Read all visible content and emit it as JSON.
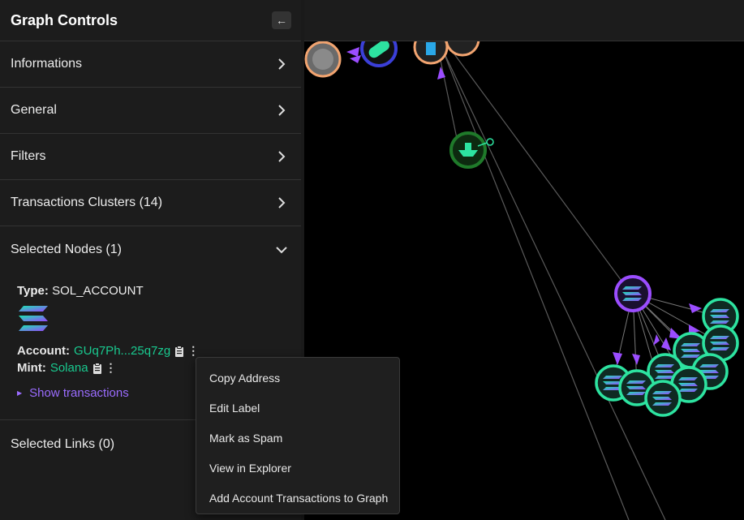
{
  "sidebar": {
    "title": "Graph Controls",
    "collapse_icon": "←",
    "sections": [
      {
        "label": "Informations"
      },
      {
        "label": "General"
      },
      {
        "label": "Filters"
      },
      {
        "label": "Transactions Clusters (14)"
      },
      {
        "label": "Selected Nodes (1)"
      }
    ],
    "selected_node": {
      "type_label": "Type:",
      "type_value": "SOL_ACCOUNT",
      "account_label": "Account:",
      "account_value": "GUq7Ph...25q7zg",
      "mint_label": "Mint:",
      "mint_value": "Solana",
      "more_icon": "⋮",
      "show_transactions": "Show transactions"
    },
    "selected_links": "Selected Links (0)"
  },
  "context_menu": {
    "items": [
      "Copy Address",
      "Edit Label",
      "Mark as Spam",
      "View in Explorer",
      "Add Account Transactions to Graph"
    ]
  },
  "colors": {
    "accent_purple": "#9b6cff",
    "address_green": "#19c98f",
    "node_orange": "#f2a470",
    "node_teal": "#2de3a0",
    "node_blue": "#3b3fd8",
    "node_dark_green": "#1f7a2a",
    "edge": "#5a5a5a"
  }
}
